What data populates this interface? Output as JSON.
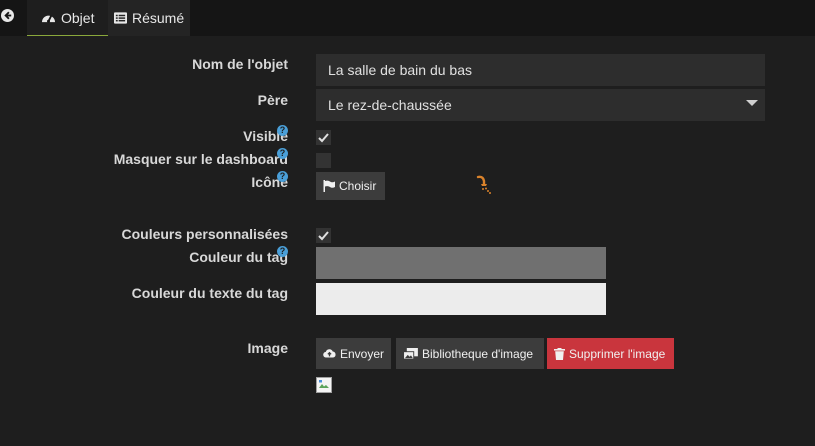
{
  "tabs": [
    {
      "label": "Objet",
      "icon": "dashboard-icon",
      "active": true
    },
    {
      "label": "Résumé",
      "icon": "list-icon",
      "active": false
    }
  ],
  "form": {
    "name_label": "Nom de l'objet",
    "name_value": "La salle de bain du bas",
    "parent_label": "Père",
    "parent_value": "Le rez-de-chaussée",
    "visible_label": "Visible",
    "visible_checked": true,
    "hide_dashboard_label": "Masquer sur le dashboard",
    "hide_dashboard_checked": false,
    "icon_label": "Icône",
    "choose_button": "Choisir",
    "selected_icon": "shower-icon",
    "custom_colors_label": "Couleurs personnalisées",
    "custom_colors_checked": true,
    "tag_color_label": "Couleur du tag",
    "tag_color": "#707070",
    "tag_text_color_label": "Couleur du texte du tag",
    "tag_text_color": "#ececec",
    "image_label": "Image",
    "upload_button": "Envoyer",
    "library_button": "Bibliotheque d'image",
    "delete_button": "Supprimer l'image"
  },
  "colors": {
    "accent": "#8aa83b",
    "help": "#4a9fd8",
    "danger": "#c9353d",
    "icon_orange": "#d9822b"
  }
}
